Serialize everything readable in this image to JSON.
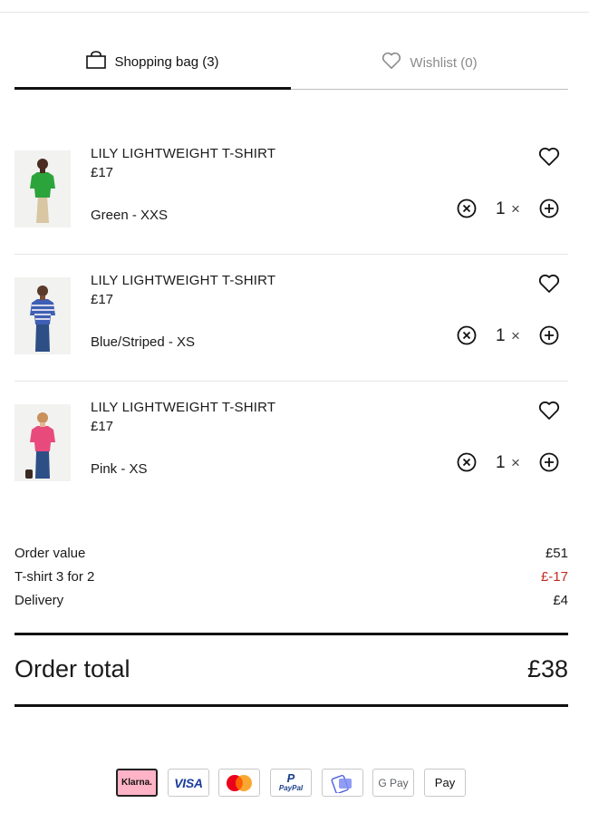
{
  "tabs": {
    "bag_label": "Shopping bag (3)",
    "wishlist_label": "Wishlist (0)"
  },
  "items": [
    {
      "name": "LILY LIGHTWEIGHT T-SHIRT",
      "price": "£17",
      "variant": "Green - XXS",
      "quantity": "1",
      "times": "×",
      "color": "#2ca43c"
    },
    {
      "name": "LILY LIGHTWEIGHT T-SHIRT",
      "price": "£17",
      "variant": "Blue/Striped - XS",
      "quantity": "1",
      "times": "×",
      "color": "#3e5fb4"
    },
    {
      "name": "LILY LIGHTWEIGHT T-SHIRT",
      "price": "£17",
      "variant": "Pink - XS",
      "quantity": "1",
      "times": "×",
      "color": "#e84a7c"
    }
  ],
  "summary": {
    "order_value_label": "Order value",
    "order_value": "£51",
    "promo_label": "T-shirt 3 for 2",
    "promo_value": "£-17",
    "delivery_label": "Delivery",
    "delivery_value": "£4"
  },
  "total": {
    "label": "Order total",
    "value": "£38"
  },
  "payments": {
    "klarna": "Klarna.",
    "visa": "VISA",
    "paypal_top": "P",
    "paypal_bottom": "PayPal",
    "gpay": "G Pay",
    "applepay": " Pay"
  },
  "colors": {
    "accent": "#111111",
    "discount": "#c42a20",
    "klarna_bg": "#ffb3c7"
  }
}
